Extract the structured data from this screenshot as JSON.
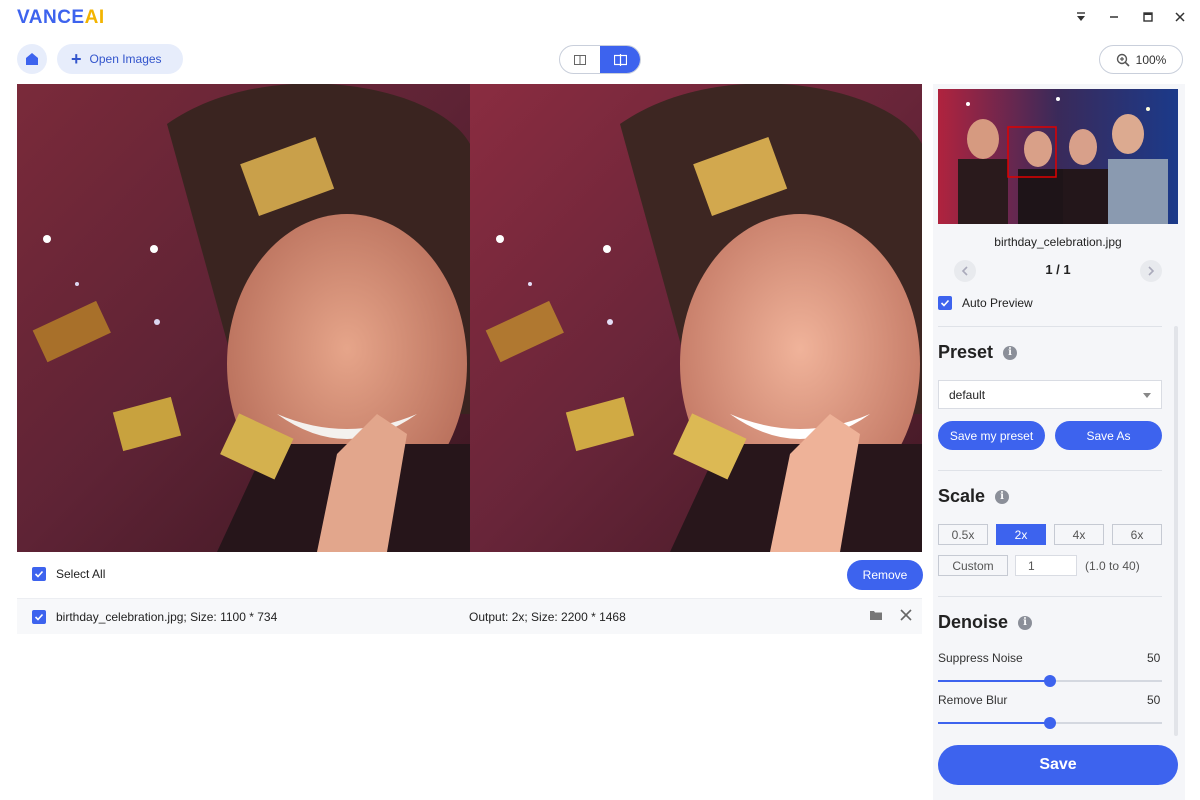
{
  "app": {
    "logo_main": "VANCE",
    "logo_ai": "AI"
  },
  "toolbar": {
    "open_images_label": "Open Images",
    "zoom": "100%"
  },
  "file": {
    "select_all_label": "Select All",
    "remove_label": "Remove",
    "row_name": "birthday_celebration.jpg; Size: 1100 * 734",
    "row_output": "Output: 2x; Size: 2200 * 1468"
  },
  "panel": {
    "thumb_name": "birthday_celebration.jpg",
    "pager": "1 / 1",
    "auto_preview_label": "Auto Preview",
    "preset": {
      "title": "Preset",
      "selected": "default",
      "save_my_preset_label": "Save my preset",
      "save_as_label": "Save As"
    },
    "scale": {
      "title": "Scale",
      "options": [
        "0.5x",
        "2x",
        "4x",
        "6x"
      ],
      "active_index": 1,
      "custom_label": "Custom",
      "custom_value": "1",
      "custom_range": "(1.0 to 40)"
    },
    "denoise": {
      "title": "Denoise",
      "suppress_noise_label": "Suppress Noise",
      "suppress_noise_value": "50",
      "remove_blur_label": "Remove Blur",
      "remove_blur_value": "50"
    },
    "save_label": "Save"
  },
  "colors": {
    "accent": "#3d63ee",
    "logo_ai": "#f3b400",
    "panel_bg": "#f5f6f9"
  }
}
